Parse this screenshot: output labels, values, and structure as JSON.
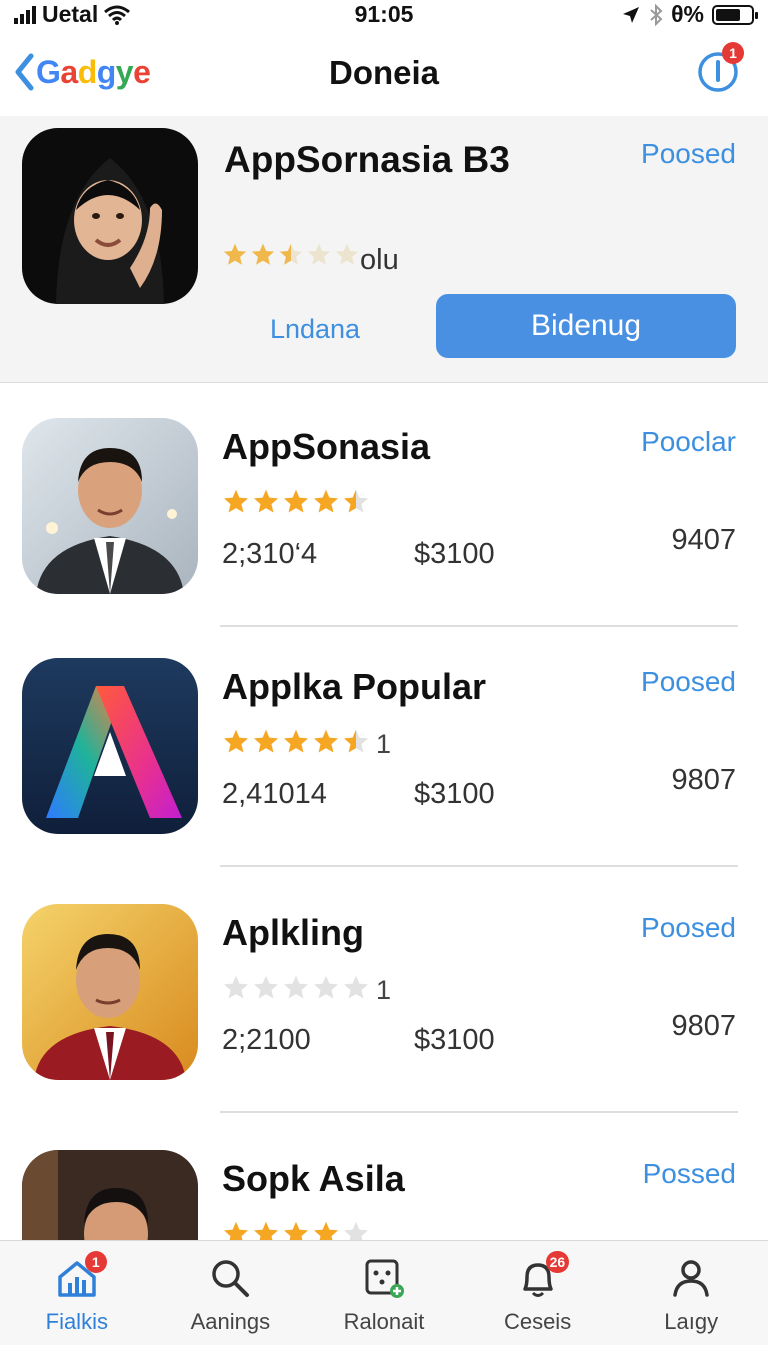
{
  "status_bar": {
    "carrier": "Uetal",
    "time": "91:05",
    "battery": "θ%",
    "battery_level": 0.7,
    "icons": [
      "signal-icon",
      "wifi-icon",
      "location-icon",
      "bluetooth-icon",
      "battery-icon"
    ]
  },
  "nav": {
    "back_label": "Gadgye",
    "title": "Doneia",
    "icon": "info-icon",
    "badge": "1"
  },
  "featured": {
    "title": "AppSornasia B3",
    "rating": 2.5,
    "rating_count": "olu",
    "status": "Poosed",
    "secondary_label": "Lndana",
    "primary_label": "Bidenug"
  },
  "apps": [
    {
      "name": "AppSonasia",
      "status": "Pooclar",
      "rating": 4.5,
      "star_note": "",
      "downloads": "2;310‘4",
      "price": "$3100",
      "score": "9407"
    },
    {
      "name": "Applka Popular",
      "status": "Poosed",
      "rating": 4.5,
      "star_note": "1",
      "downloads": "2,41014",
      "price": "$3100",
      "score": "9807"
    },
    {
      "name": "Aplkling",
      "status": "Poosed",
      "rating": 0,
      "star_note": "1",
      "downloads": "2;2100",
      "price": "$3100",
      "score": "9807"
    },
    {
      "name": "Sopk Asila",
      "status": "Possed",
      "rating": 4,
      "star_note": "",
      "downloads": "",
      "price": "",
      "score": ""
    }
  ],
  "tabs": [
    {
      "label": "Fialkis",
      "icon": "home-chart-icon",
      "badge": "1",
      "active": true
    },
    {
      "label": "Aanings",
      "icon": "search-icon",
      "badge": "",
      "active": false
    },
    {
      "label": "Ralonait",
      "icon": "games-icon",
      "badge": "",
      "active": false
    },
    {
      "label": "Ceseis",
      "icon": "bell-icon",
      "badge": "26",
      "active": false
    },
    {
      "label": "Laıgy",
      "icon": "person-icon",
      "badge": "",
      "active": false
    }
  ],
  "colors": {
    "accent": "#3d8fe0",
    "primary_button": "#4a90e2",
    "star": "#f5a623",
    "badge": "#e53935"
  }
}
